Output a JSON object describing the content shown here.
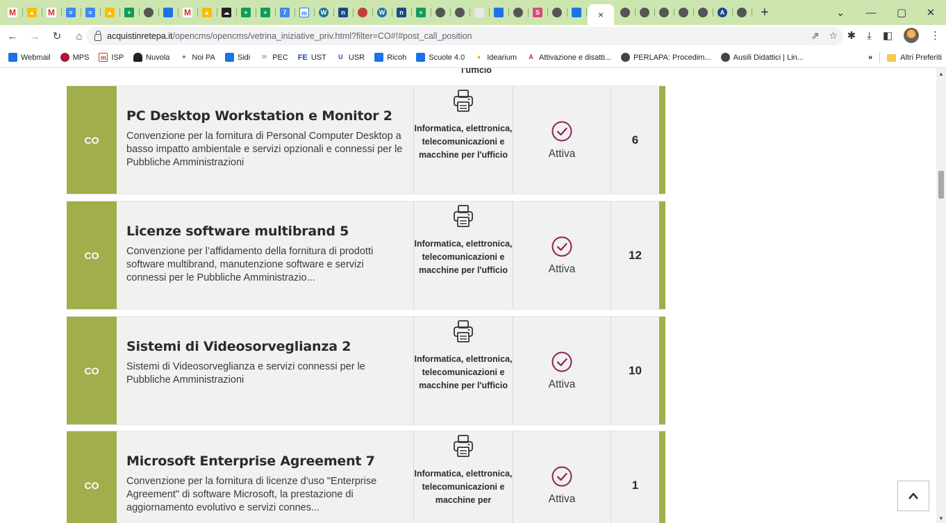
{
  "browser": {
    "url_host": "acquistinretepa.it",
    "url_path": "/opencms/opencms/vetrina_iniziative_priv.html?filter=CO#!#post_call_position",
    "new_tab": "+",
    "close_tab": "×"
  },
  "bookmarks": {
    "items": [
      "Webmail",
      "MPS",
      "ISP",
      "Nuvola",
      "Noi PA",
      "Sidi",
      "PEC",
      "UST",
      "USR",
      "Ricoh",
      "Scuole 4.0",
      "Idearium",
      "Attivazione e disatti...",
      "PERLAPA: Procedim...",
      "Ausili Didattici | Lin..."
    ],
    "fe_prefix": "FE",
    "more": "»",
    "other": "Altri Preferiti"
  },
  "page": {
    "top_fragment": "l'ufficio",
    "rows": [
      {
        "category": "CO",
        "title": "PC Desktop Workstation e Monitor 2",
        "description": "Convenzione per la fornitura di Personal Computer Desktop a basso impatto ambientale e servizi opzionali e connessi per le Pubbliche Amministrazioni",
        "sector": "Informatica, elettronica, telecomunicazioni e macchine per l'ufficio",
        "status": "Attiva",
        "count": "6"
      },
      {
        "category": "CO",
        "title": "Licenze software multibrand 5",
        "description": "Convenzione per l’affidamento della fornitura di prodotti software multibrand, manutenzione software e servizi connessi per le Pubbliche Amministrazio...",
        "sector": "Informatica, elettronica, telecomunicazioni e macchine per l'ufficio",
        "status": "Attiva",
        "count": "12"
      },
      {
        "category": "CO",
        "title": "Sistemi di Videosorveglianza 2",
        "description": "Sistemi di Videosorveglianza e servizi connessi per le Pubbliche Amministrazioni",
        "sector": "Informatica, elettronica, telecomunicazioni e macchine per l'ufficio",
        "status": "Attiva",
        "count": "10"
      },
      {
        "category": "CO",
        "title": "Microsoft Enterprise Agreement 7",
        "description": "Convenzione per la fornitura di licenze d'uso \"Enterprise Agreement\" di software Microsoft, la prestazione di aggiornamento evolutivo e servizi connes...",
        "sector": "Informatica, elettronica, telecomunicazioni e macchine per",
        "status": "Attiva",
        "count": "1"
      }
    ]
  },
  "colors": {
    "accent_green": "#a2ad4c",
    "status_icon": "#8b2252",
    "tabstrip": "#cde6b0"
  }
}
